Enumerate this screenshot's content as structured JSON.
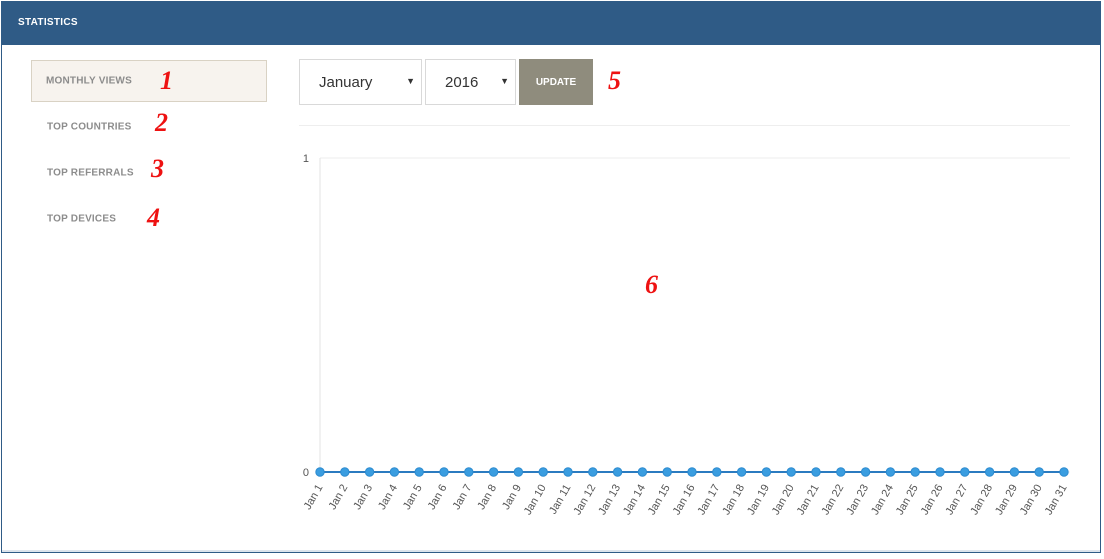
{
  "panel": {
    "title": "STATISTICS"
  },
  "menu": {
    "items": [
      {
        "label": "MONTHLY VIEWS",
        "active": true
      },
      {
        "label": "TOP COUNTRIES",
        "active": false
      },
      {
        "label": "TOP REFERRALS",
        "active": false
      },
      {
        "label": "TOP DEVICES",
        "active": false
      }
    ]
  },
  "controls": {
    "month": "January",
    "year": "2016",
    "update_label": "UPDATE",
    "dropdown_icon": "caret-down-icon"
  },
  "annotations": [
    "1",
    "2",
    "3",
    "4",
    "5",
    "6"
  ],
  "colors": {
    "header": "#2f5b86",
    "line": "#2b7bc0",
    "point": "#3a9de0",
    "update_button": "#8f8c7d",
    "annotation": "#ee1111"
  },
  "chart_data": {
    "type": "line",
    "title": "",
    "xlabel": "",
    "ylabel": "",
    "ylim": [
      0,
      1
    ],
    "y_ticks": [
      "0",
      "1"
    ],
    "grid": true,
    "categories": [
      "Jan 1",
      "Jan 2",
      "Jan 3",
      "Jan 4",
      "Jan 5",
      "Jan 6",
      "Jan 7",
      "Jan 8",
      "Jan 9",
      "Jan 10",
      "Jan 11",
      "Jan 12",
      "Jan 13",
      "Jan 14",
      "Jan 15",
      "Jan 16",
      "Jan 17",
      "Jan 18",
      "Jan 19",
      "Jan 20",
      "Jan 21",
      "Jan 22",
      "Jan 23",
      "Jan 24",
      "Jan 25",
      "Jan 26",
      "Jan 27",
      "Jan 28",
      "Jan 29",
      "Jan 30",
      "Jan 31"
    ],
    "series": [
      {
        "values": [
          0,
          0,
          0,
          0,
          0,
          0,
          0,
          0,
          0,
          0,
          0,
          0,
          0,
          0,
          0,
          0,
          0,
          0,
          0,
          0,
          0,
          0,
          0,
          0,
          0,
          0,
          0,
          0,
          0,
          0,
          0
        ]
      }
    ]
  }
}
